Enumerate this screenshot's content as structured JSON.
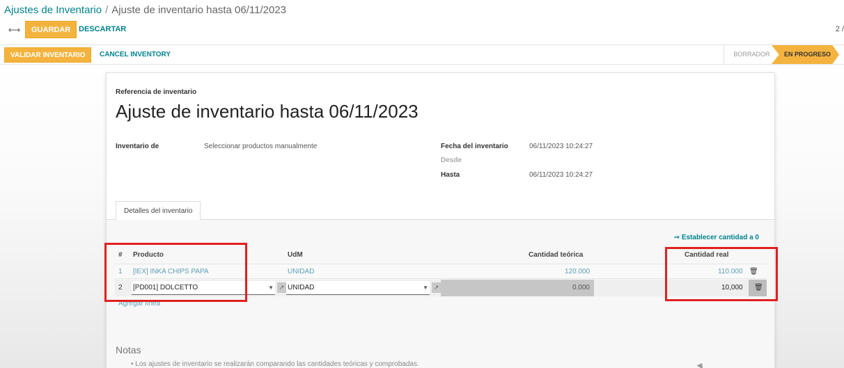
{
  "breadcrumb": {
    "parent": "Ajustes de Inventario",
    "separator": "/",
    "current": "Ajuste de inventario hasta 06/11/2023"
  },
  "toolbar": {
    "save_label": "GUARDAR",
    "discard_label": "DESCARTAR",
    "pager": "2 /"
  },
  "statusbar": {
    "validate_label": "VALIDAR INVENTARIO",
    "cancel_label": "CANCEL INVENTORY",
    "stages": [
      {
        "label": "BORRADOR",
        "active": false
      },
      {
        "label": "EN PROGRESO",
        "active": true
      }
    ]
  },
  "form": {
    "ref_label": "Referencia de inventario",
    "title": "Ajuste de inventario hasta 06/11/2023",
    "inventory_of_label": "Inventario de",
    "inventory_of_value": "Seleccionar productos manualmente",
    "date_label": "Fecha del inventario",
    "date_value": "06/11/2023 10:24:27",
    "from_label": "Desde",
    "to_label": "Hasta",
    "to_value": "06/11/2023 10:24:27"
  },
  "tabs": [
    {
      "label": "Detalles del inventario"
    }
  ],
  "lines": {
    "set_zero_label": "⇒ Establecer cantidad a 0",
    "columns": {
      "num": "#",
      "product": "Producto",
      "uom": "UdM",
      "theoretical": "Cantidad teórica",
      "real": "Cantidad real"
    },
    "rows": [
      {
        "num": "1",
        "product": "[IEX] INKA CHIPS PAPA",
        "uom": "UNIDAD",
        "theoretical": "120.000",
        "real": "110.000"
      },
      {
        "num": "2",
        "product": "[PD001] DOLCETTO",
        "uom": "UNIDAD",
        "theoretical": "0.000",
        "real": "10,000"
      }
    ],
    "add_line_label": "Agregar línea"
  },
  "notes": {
    "title": "Notas",
    "items": [
      "Los ajustes de inventario se realizarán comparando las cantidades teóricas y comprobadas."
    ]
  },
  "colors": {
    "accent": "#f4b33e",
    "link": "#00838f",
    "highlight": "#e02020"
  }
}
